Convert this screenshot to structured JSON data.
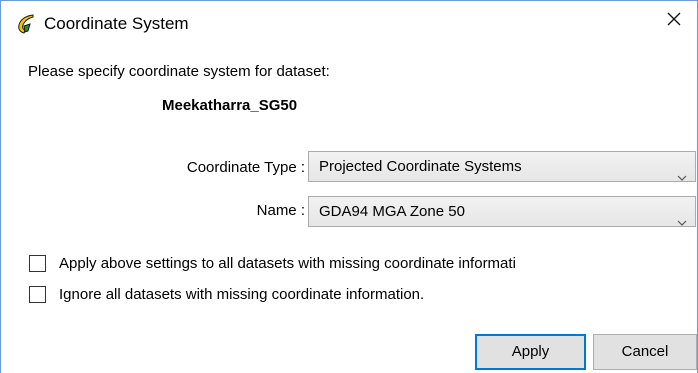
{
  "window": {
    "title": "Coordinate System",
    "icon": "app-logo-icon",
    "close_icon": "close-icon"
  },
  "prompt": "Please specify coordinate system for dataset:",
  "dataset_name": "Meekatharra_SG50",
  "fields": {
    "coordinate_type": {
      "label": "Coordinate Type :",
      "value": "Projected Coordinate Systems"
    },
    "name": {
      "label": "Name :",
      "value": "GDA94 MGA Zone 50"
    }
  },
  "options": {
    "apply_all": {
      "label": "Apply above settings to all datasets with missing coordinate informati",
      "checked": false
    },
    "ignore_all": {
      "label": "Ignore all datasets with missing coordinate information.",
      "checked": false
    }
  },
  "buttons": {
    "apply": "Apply",
    "cancel": "Cancel"
  },
  "colors": {
    "accent": "#0078d7",
    "logo_yellow": "#f2c500",
    "logo_green": "#2e8b2e"
  }
}
